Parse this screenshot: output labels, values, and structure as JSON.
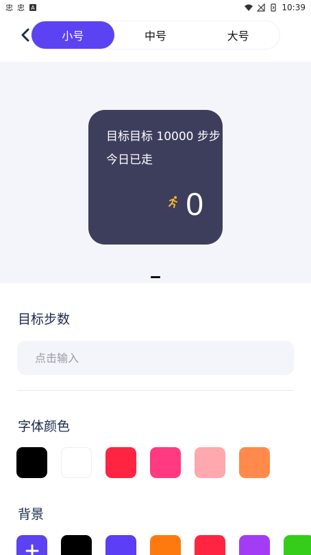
{
  "status_bar": {
    "time": "10:39"
  },
  "header": {
    "tabs": [
      {
        "label": "小号",
        "active": true
      },
      {
        "label": "中号",
        "active": false
      },
      {
        "label": "大号",
        "active": false
      }
    ]
  },
  "preview": {
    "goal_text": "目标目标 10000 步步",
    "today_text": "今日已走",
    "count": "0",
    "widget_bg": "#3d3d5c",
    "runner_color": "#f5b82e"
  },
  "goal": {
    "title": "目标步数",
    "placeholder": "点击输入"
  },
  "font_color": {
    "title": "字体颜色",
    "colors": [
      "#000000",
      "#ffffff",
      "#ff2442",
      "#ff3a80",
      "#ffa8ae",
      "#ff8a4c"
    ]
  },
  "background": {
    "title": "背景",
    "add_color": "#5b42f3",
    "colors": [
      "#000000",
      "#5b3ef5",
      "#ff7a0e",
      "#ff2442",
      "#a33cf5",
      "#35cc1a"
    ]
  }
}
